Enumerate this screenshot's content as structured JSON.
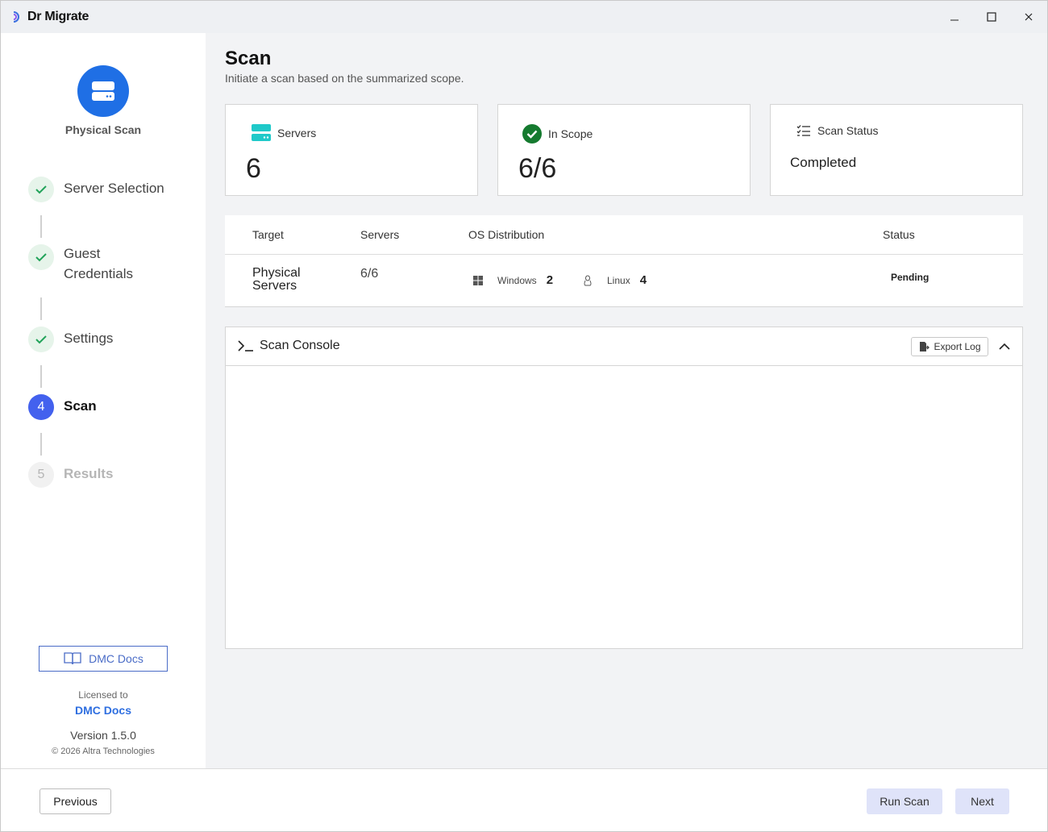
{
  "app": {
    "title": "Dr Migrate",
    "controls": {
      "minimize": "—",
      "maximize": "☐",
      "close": "✕"
    }
  },
  "sidebar": {
    "header_label": "Physical Scan",
    "steps": [
      {
        "label": "Server Selection",
        "state": "done"
      },
      {
        "label": "Guest Credentials",
        "line1": "Guest",
        "line2": "Credentials",
        "state": "done"
      },
      {
        "label": "Settings",
        "state": "done"
      },
      {
        "label": "Scan",
        "number": "4",
        "state": "active"
      },
      {
        "label": "Results",
        "number": "5",
        "state": "todo"
      }
    ],
    "docs_button": "DMC Docs",
    "licensed_to_label": "Licensed to",
    "licensee": "DMC Docs",
    "version": "Version 1.5.0",
    "copyright": "© 2026 Altra Technologies"
  },
  "main": {
    "title": "Scan",
    "subtitle": "Initiate a scan based on the summarized scope.",
    "cards": {
      "servers": {
        "label": "Servers",
        "value": "6"
      },
      "in_scope": {
        "label": "In Scope",
        "value": "6/6"
      },
      "scan_status": {
        "label": "Scan Status",
        "value": "Completed"
      }
    },
    "table": {
      "headers": {
        "target": "Target",
        "servers": "Servers",
        "os": "OS Distribution",
        "status": "Status"
      },
      "row": {
        "target_line1": "Physical",
        "target_line2": "Servers",
        "servers": "6/6",
        "windows_label": "Windows",
        "windows_count": "2",
        "linux_label": "Linux",
        "linux_count": "4",
        "status": "Pending"
      }
    },
    "console": {
      "title": "Scan Console",
      "export_label": "Export Log"
    }
  },
  "footer": {
    "previous": "Previous",
    "run_scan": "Run Scan",
    "next": "Next"
  },
  "colors": {
    "accent": "#4361ee",
    "brand_blue": "#1f6fe5",
    "done_green": "#22a35a",
    "servers_teal": "#1fc9c9",
    "in_scope_green": "#157a2f"
  }
}
